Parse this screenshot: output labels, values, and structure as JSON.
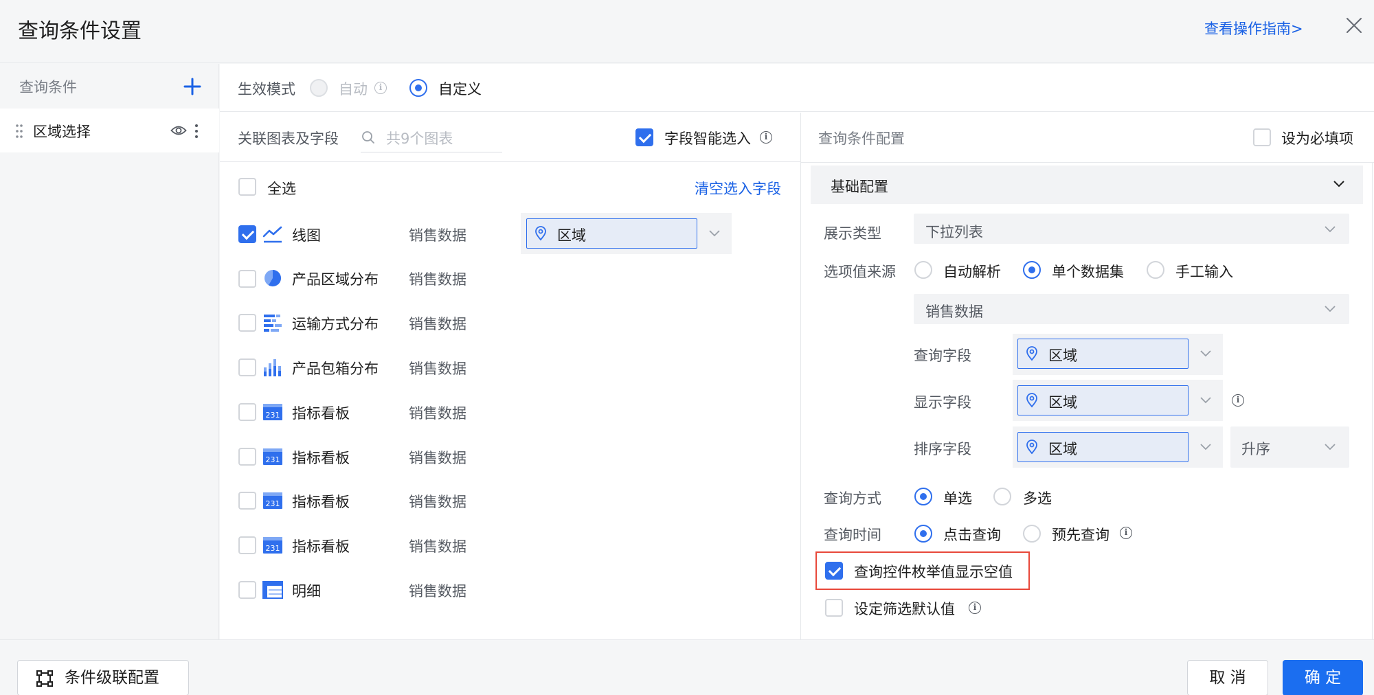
{
  "header": {
    "title": "查询条件设置",
    "guide_link": "查看操作指南>"
  },
  "sidebar": {
    "title": "查询条件",
    "items": [
      {
        "label": "区域选择"
      }
    ]
  },
  "mode": {
    "label": "生效模式",
    "options": [
      {
        "label": "自动",
        "selected": false,
        "disabled": true
      },
      {
        "label": "自定义",
        "selected": true
      }
    ]
  },
  "charts_panel": {
    "header_label": "关联图表及字段",
    "search_placeholder": "共9个图表",
    "smart_select_label": "字段智能选入",
    "smart_select_checked": true,
    "select_all_label": "全选",
    "clear_link": "清空选入字段",
    "rows": [
      {
        "name": "线图",
        "icon": "line-chart-icon",
        "dataset": "销售数据",
        "checked": true,
        "field": "区域"
      },
      {
        "name": "产品区域分布",
        "icon": "pie-chart-icon",
        "dataset": "销售数据",
        "checked": false
      },
      {
        "name": "运输方式分布",
        "icon": "bar-chart-horizontal-icon",
        "dataset": "销售数据",
        "checked": false
      },
      {
        "name": "产品包箱分布",
        "icon": "bar-chart-icon",
        "dataset": "销售数据",
        "checked": false
      },
      {
        "name": "指标看板",
        "icon": "kpi-card-icon",
        "dataset": "销售数据",
        "checked": false
      },
      {
        "name": "指标看板",
        "icon": "kpi-card-icon",
        "dataset": "销售数据",
        "checked": false
      },
      {
        "name": "指标看板",
        "icon": "kpi-card-icon",
        "dataset": "销售数据",
        "checked": false
      },
      {
        "name": "指标看板",
        "icon": "kpi-card-icon",
        "dataset": "销售数据",
        "checked": false
      },
      {
        "name": "明细",
        "icon": "table-icon",
        "dataset": "销售数据",
        "checked": false
      }
    ],
    "kpi_icon_text": "231"
  },
  "config_panel": {
    "header_label": "查询条件配置",
    "required_label": "设为必填项",
    "required_checked": false,
    "section_title": "基础配置",
    "display_type_label": "展示类型",
    "display_type_value": "下拉列表",
    "source_label": "选项值来源",
    "source_options": [
      {
        "label": "自动解析",
        "selected": false
      },
      {
        "label": "单个数据集",
        "selected": true
      },
      {
        "label": "手工输入",
        "selected": false
      }
    ],
    "dataset_value": "销售数据",
    "query_field_label": "查询字段",
    "query_field_value": "区域",
    "display_field_label": "显示字段",
    "display_field_value": "区域",
    "sort_field_label": "排序字段",
    "sort_field_value": "区域",
    "sort_order_value": "升序",
    "query_mode_label": "查询方式",
    "query_mode_options": [
      {
        "label": "单选",
        "selected": true
      },
      {
        "label": "多选",
        "selected": false
      }
    ],
    "query_time_label": "查询时间",
    "query_time_options": [
      {
        "label": "点击查询",
        "selected": true
      },
      {
        "label": "预先查询",
        "selected": false
      }
    ],
    "show_empty_label": "查询控件枚举值显示空值",
    "show_empty_checked": true,
    "default_value_label": "设定筛选默认值",
    "default_value_checked": false
  },
  "footer": {
    "cascade_label": "条件级联配置",
    "cancel_label": "取 消",
    "confirm_label": "确 定"
  },
  "colors": {
    "primary": "#1b6ef0",
    "link": "#1b62e5",
    "highlight": "#e8483a"
  }
}
